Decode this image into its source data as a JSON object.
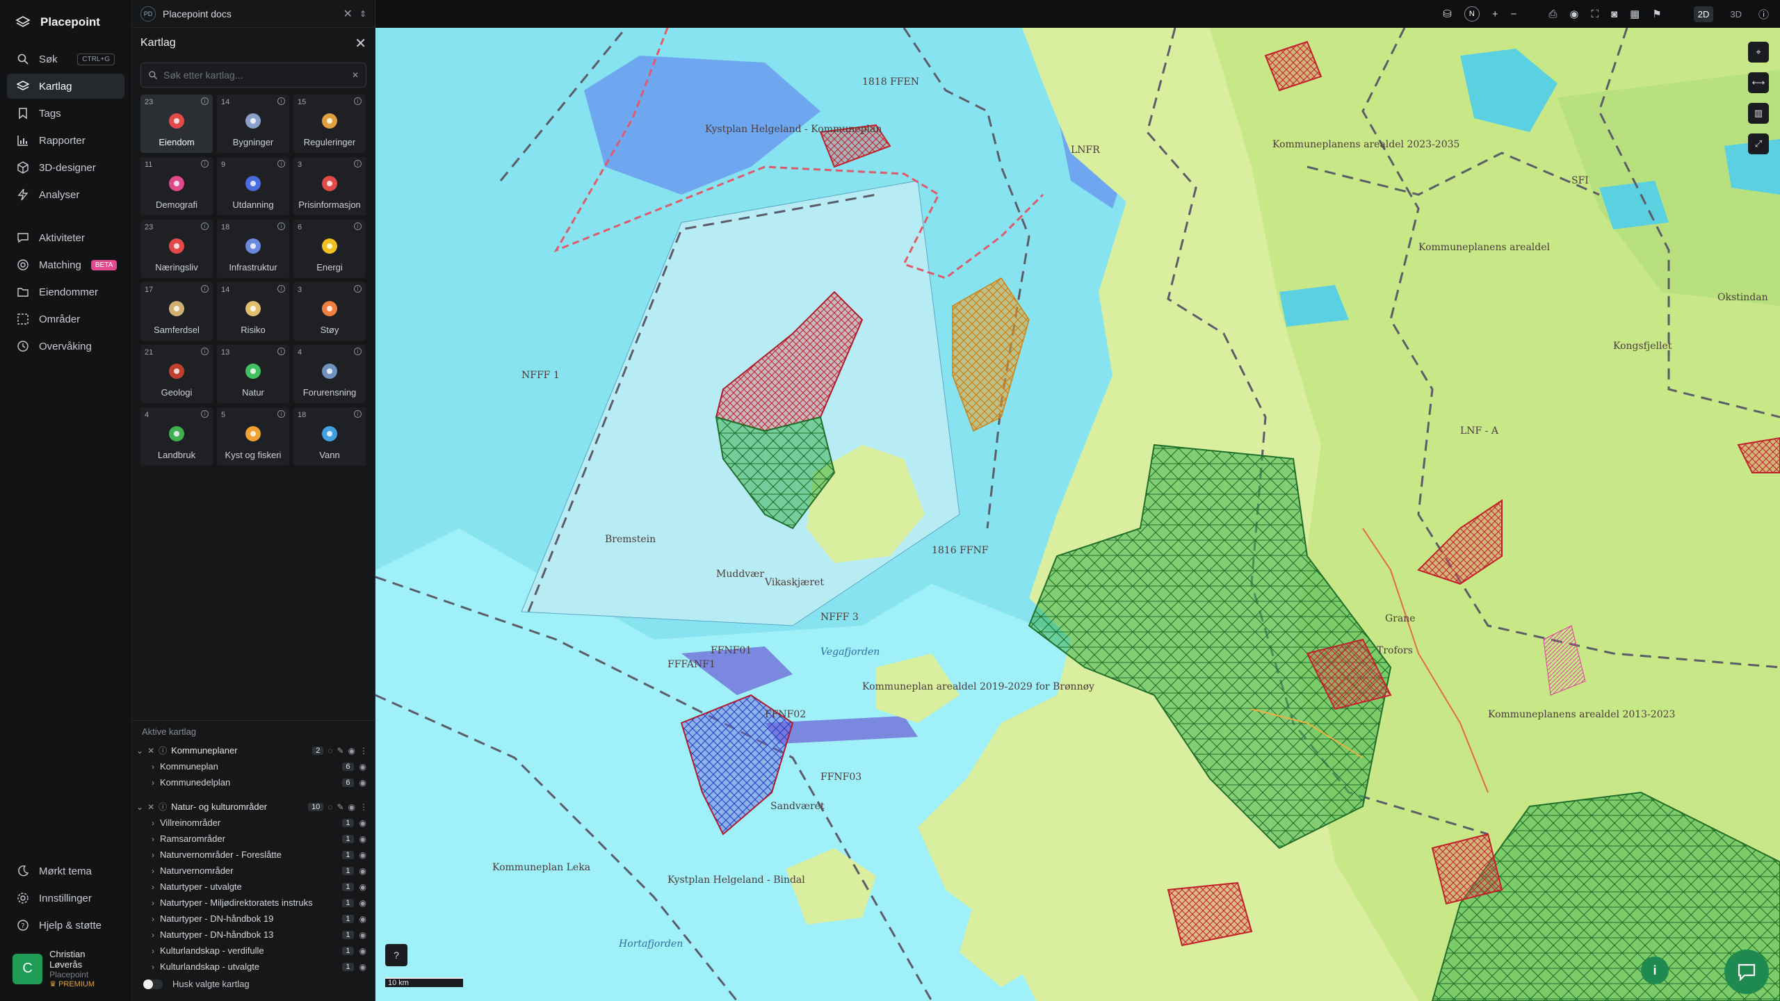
{
  "app": {
    "name": "Placepoint"
  },
  "nav": {
    "items": [
      {
        "label": "Søk",
        "shortcut": "CTRL+G",
        "icon": "search-icon"
      },
      {
        "label": "Kartlag",
        "icon": "layers-icon",
        "active": true
      },
      {
        "label": "Tags",
        "icon": "bookmark-icon"
      },
      {
        "label": "Rapporter",
        "icon": "bar-chart-icon"
      },
      {
        "label": "3D-designer",
        "icon": "cube-icon"
      },
      {
        "label": "Analyser",
        "icon": "bolt-icon"
      }
    ],
    "items2": [
      {
        "label": "Aktiviteter",
        "icon": "chat-icon"
      },
      {
        "label": "Matching",
        "badge": "BETA",
        "icon": "target-icon"
      },
      {
        "label": "Eiendommer",
        "icon": "folder-icon"
      },
      {
        "label": "Områder",
        "icon": "area-icon"
      },
      {
        "label": "Overvåking",
        "icon": "clock-icon"
      }
    ],
    "bottom": [
      {
        "label": "Mørkt tema",
        "icon": "moon-icon"
      },
      {
        "label": "Innstillinger",
        "icon": "gear-icon"
      },
      {
        "label": "Hjelp & støtte",
        "icon": "help-icon"
      }
    ],
    "user": {
      "initial": "C",
      "name": "Christian Løverås",
      "org": "Placepoint",
      "plan": "PREMIUM"
    }
  },
  "doc": {
    "badge": "PD",
    "name": "Placepoint docs"
  },
  "panel": {
    "title": "Kartlag",
    "search_placeholder": "Søk etter kartlag...",
    "tiles": [
      {
        "count": "23",
        "label": "Eiendom",
        "icon": "pin-icon",
        "color": "#e24a4a",
        "active": true
      },
      {
        "count": "14",
        "label": "Bygninger",
        "icon": "building-icon",
        "color": "#8aa0c8"
      },
      {
        "count": "15",
        "label": "Reguleringer",
        "icon": "signpost-icon",
        "color": "#e0a040"
      },
      {
        "count": "11",
        "label": "Demografi",
        "icon": "people-icon",
        "color": "#e04a8a"
      },
      {
        "count": "9",
        "label": "Utdanning",
        "icon": "graduation-icon",
        "color": "#4a6ae0"
      },
      {
        "count": "3",
        "label": "Prisinformasjon",
        "icon": "bag-icon",
        "color": "#e24a4a"
      },
      {
        "count": "23",
        "label": "Næringsliv",
        "icon": "briefcase-icon",
        "color": "#e24a4a"
      },
      {
        "count": "18",
        "label": "Infrastruktur",
        "icon": "globe-icon",
        "color": "#6a8ae0"
      },
      {
        "count": "6",
        "label": "Energi",
        "icon": "lightning-icon",
        "color": "#f0c020"
      },
      {
        "count": "17",
        "label": "Samferdsel",
        "icon": "bus-icon",
        "color": "#d0b070"
      },
      {
        "count": "14",
        "label": "Risiko",
        "icon": "warning-icon",
        "color": "#e0c070"
      },
      {
        "count": "3",
        "label": "Støy",
        "icon": "noise-icon",
        "color": "#f08040"
      },
      {
        "count": "21",
        "label": "Geologi",
        "icon": "terrain-icon",
        "color": "#c04030"
      },
      {
        "count": "13",
        "label": "Natur",
        "icon": "leaf-icon",
        "color": "#40c060"
      },
      {
        "count": "4",
        "label": "Forurensning",
        "icon": "factory-icon",
        "color": "#7090c0"
      },
      {
        "count": "4",
        "label": "Landbruk",
        "icon": "sprout-icon",
        "color": "#40b050"
      },
      {
        "count": "5",
        "label": "Kyst og fiskeri",
        "icon": "fish-icon",
        "color": "#f0a030"
      },
      {
        "count": "18",
        "label": "Vann",
        "icon": "droplet-icon",
        "color": "#40a0e0"
      }
    ],
    "active_header": "Aktive kartlag",
    "groups": [
      {
        "name": "Kommuneplaner",
        "count": "2",
        "rows": [
          {
            "label": "Kommuneplan",
            "count": "6"
          },
          {
            "label": "Kommunedelplan",
            "count": "6"
          }
        ]
      },
      {
        "name": "Natur- og kulturområder",
        "count": "10",
        "rows": [
          {
            "label": "Villreinområder",
            "count": "1"
          },
          {
            "label": "Ramsarområder",
            "count": "1"
          },
          {
            "label": "Naturvernområder - Foreslåtte",
            "count": "1"
          },
          {
            "label": "Naturvernområder",
            "count": "1"
          },
          {
            "label": "Naturtyper - utvalgte",
            "count": "1"
          },
          {
            "label": "Naturtyper - Miljødirektoratets instruks",
            "count": "1"
          },
          {
            "label": "Naturtyper - DN-håndbok 19",
            "count": "1"
          },
          {
            "label": "Naturtyper - DN-håndbok 13",
            "count": "1"
          },
          {
            "label": "Kulturlandskap - verdifulle",
            "count": "1"
          },
          {
            "label": "Kulturlandskap - utvalgte",
            "count": "1"
          }
        ]
      }
    ],
    "remember_label": "Husk valgte kartlag"
  },
  "toolbar": {
    "north": "N",
    "mode_2d": "2D",
    "mode_3d": "3D"
  },
  "map": {
    "scale_label": "10 km",
    "labels": [
      "Kystplan Helgeland - Kommuneplan",
      "Kommuneplanens arealdel 2023-2035",
      "Kommuneplan Leka",
      "Kystplan Helgeland - Bindal",
      "Kommuneplanens arealdel 2013-2023",
      "Kommuneplanens arealdel",
      "Kommuneplan arealdel 2019-2029 for Brønnøy",
      "Bremstein",
      "Vikaskjæret",
      "Sandværet",
      "Hortafjorden",
      "Okstindan",
      "Grane",
      "Trofors",
      "Kongsfjellet",
      "Muddvær",
      "Vegafjorden",
      "FFFANF1",
      "FFNF01",
      "FFNF02",
      "FFNF03",
      "NFFF 3",
      "NFFF 1",
      "1818 FFEN",
      "1816 FFNF",
      "LNF - A",
      "LNFR",
      "SFI"
    ]
  }
}
